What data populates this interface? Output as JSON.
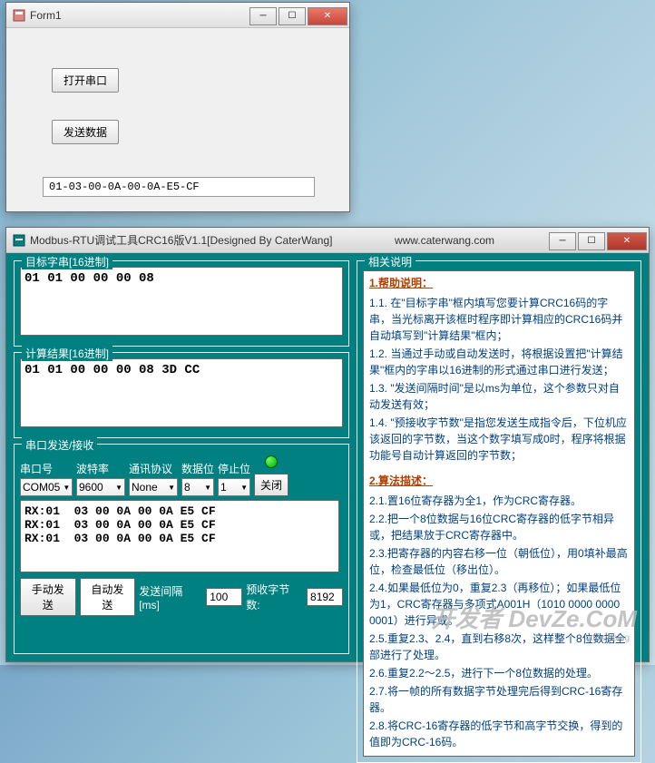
{
  "form1": {
    "title": "Form1",
    "btn_open": "打开串口",
    "btn_send": "发送数据",
    "output": "01-03-00-0A-00-0A-E5-CF"
  },
  "modbus": {
    "title": "Modbus-RTU调试工具CRC16版V1.1[Designed By CaterWang]",
    "url": "www.caterwang.com",
    "target_legend": "目标字串[16进制]",
    "target_value": "01 01 00 00 00 08",
    "result_legend": "计算结果[16进制]",
    "result_value": "01 01 00 00 00 08 3D CC",
    "serial_legend": "串口发送/接收",
    "labels": {
      "port": "串口号",
      "baud": "波特率",
      "proto": "通讯协议",
      "databits": "数据位",
      "stopbits": "停止位"
    },
    "values": {
      "port": "COM05",
      "baud": "9600",
      "proto": "None",
      "databits": "8",
      "stopbits": "1"
    },
    "btn_close": "关闭",
    "rx_lines": "RX:01  03 00 0A 00 0A E5 CF\nRX:01  03 00 0A 00 0A E5 CF\nRX:01  03 00 0A 00 0A E5 CF",
    "btn_manual": "手动发送",
    "btn_auto": "自动发送",
    "lbl_interval": "发送间隔[ms]",
    "val_interval": "100",
    "lbl_prebytes": "预收字节数:",
    "val_prebytes": "8192",
    "desc_legend": "相关说明",
    "help_title": "1.帮助说明：",
    "help": {
      "l1": "1.1. 在\"目标字串\"框内填写您要计算CRC16码的字串，当光标离开该框时程序即计算相应的CRC16码并自动填写到\"计算结果\"框内；",
      "l2": "1.2. 当通过手动或自动发送时，将根据设置把\"计算结果\"框内的字串以16进制的形式通过串口进行发送；",
      "l3": "1.3. \"发送间隔时间\"是以ms为单位，这个参数只对自动发送有效；",
      "l4": "1.4. \"预接收字节数\"是指您发送生成指令后，下位机应该返回的字节数，当这个数字填写成0时，程序将根据功能号自动计算返回的字节数；"
    },
    "algo_title": "2.算法描述：",
    "algo": {
      "l1": "2.1.置16位寄存器为全1，作为CRC寄存器。",
      "l2": "2.2.把一个8位数据与16位CRC寄存器的低字节相异或，把结果放于CRC寄存器中。",
      "l3": "2.3.把寄存器的内容右移一位（朝低位），用0填补最高位，检查最低位（移出位）。",
      "l4": "2.4.如果最低位为0，重复2.3（再移位）；如果最低位为1，CRC寄存器与多项式A001H（1010 0000 0000 0001）进行异或。",
      "l5": "2.5.重复2.3、2.4，直到右移8次，这样整个8位数据全部进行了处理。",
      "l6": "2.6.重复2.2～2.5，进行下一个8位数据的处理。",
      "l7": "2.7.将一帧的所有数据字节处理完后得到CRC-16寄存器。",
      "l8": "2.8.将CRC-16寄存器的低字节和高字节交换，得到的值即为CRC-16码。"
    }
  },
  "watermark": "开发者 DevZe.CoM",
  "watermark_url": "https://blog"
}
